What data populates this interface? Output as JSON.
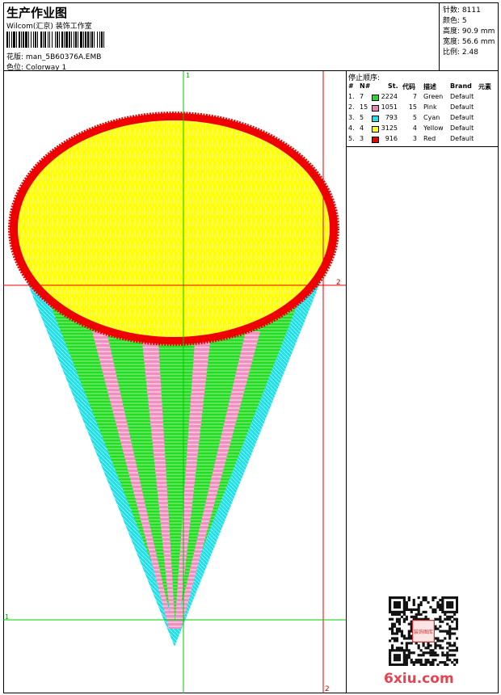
{
  "header": {
    "title": "生产作业图",
    "company": "Wilcom(汇京) 装饰工作室",
    "design_label": "花版:",
    "design_value": "man_5B60376A.EMB",
    "colorway_label": "色位:",
    "colorway_value": "Colorway 1"
  },
  "stats": [
    {
      "label": "针数:",
      "value": "8111"
    },
    {
      "label": "颜色:",
      "value": "5"
    },
    {
      "label": "高度:",
      "value": "90.9 mm"
    },
    {
      "label": "宽度:",
      "value": "56.6 mm"
    },
    {
      "label": "比例:",
      "value": "2.48"
    }
  ],
  "stop_sequence": {
    "title": "停止顺序:",
    "columns": [
      "#",
      "N#",
      "St.",
      "代码",
      "描述",
      "Brand",
      "元素"
    ],
    "rows": [
      {
        "idx": "1.",
        "n": "7",
        "color": "#22dd22",
        "st": "2224",
        "code": "7",
        "desc": "Green",
        "brand": "Default"
      },
      {
        "idx": "2.",
        "n": "15",
        "color": "#f07fb8",
        "st": "1051",
        "code": "15",
        "desc": "Pink",
        "brand": "Default"
      },
      {
        "idx": "3.",
        "n": "5",
        "color": "#22e0e8",
        "st": "793",
        "code": "5",
        "desc": "Cyan",
        "brand": "Default"
      },
      {
        "idx": "4.",
        "n": "4",
        "color": "#ffff00",
        "st": "3125",
        "code": "4",
        "desc": "Yellow",
        "brand": "Default"
      },
      {
        "idx": "5.",
        "n": "3",
        "color": "#ee0000",
        "st": "916",
        "code": "3",
        "desc": "Red",
        "brand": "Default"
      }
    ]
  },
  "guides": {
    "h1": "1",
    "h2": "2",
    "v1": "1",
    "v2": "2"
  },
  "watermark": "6xiu.com",
  "qr_stamp": "装饰图库"
}
